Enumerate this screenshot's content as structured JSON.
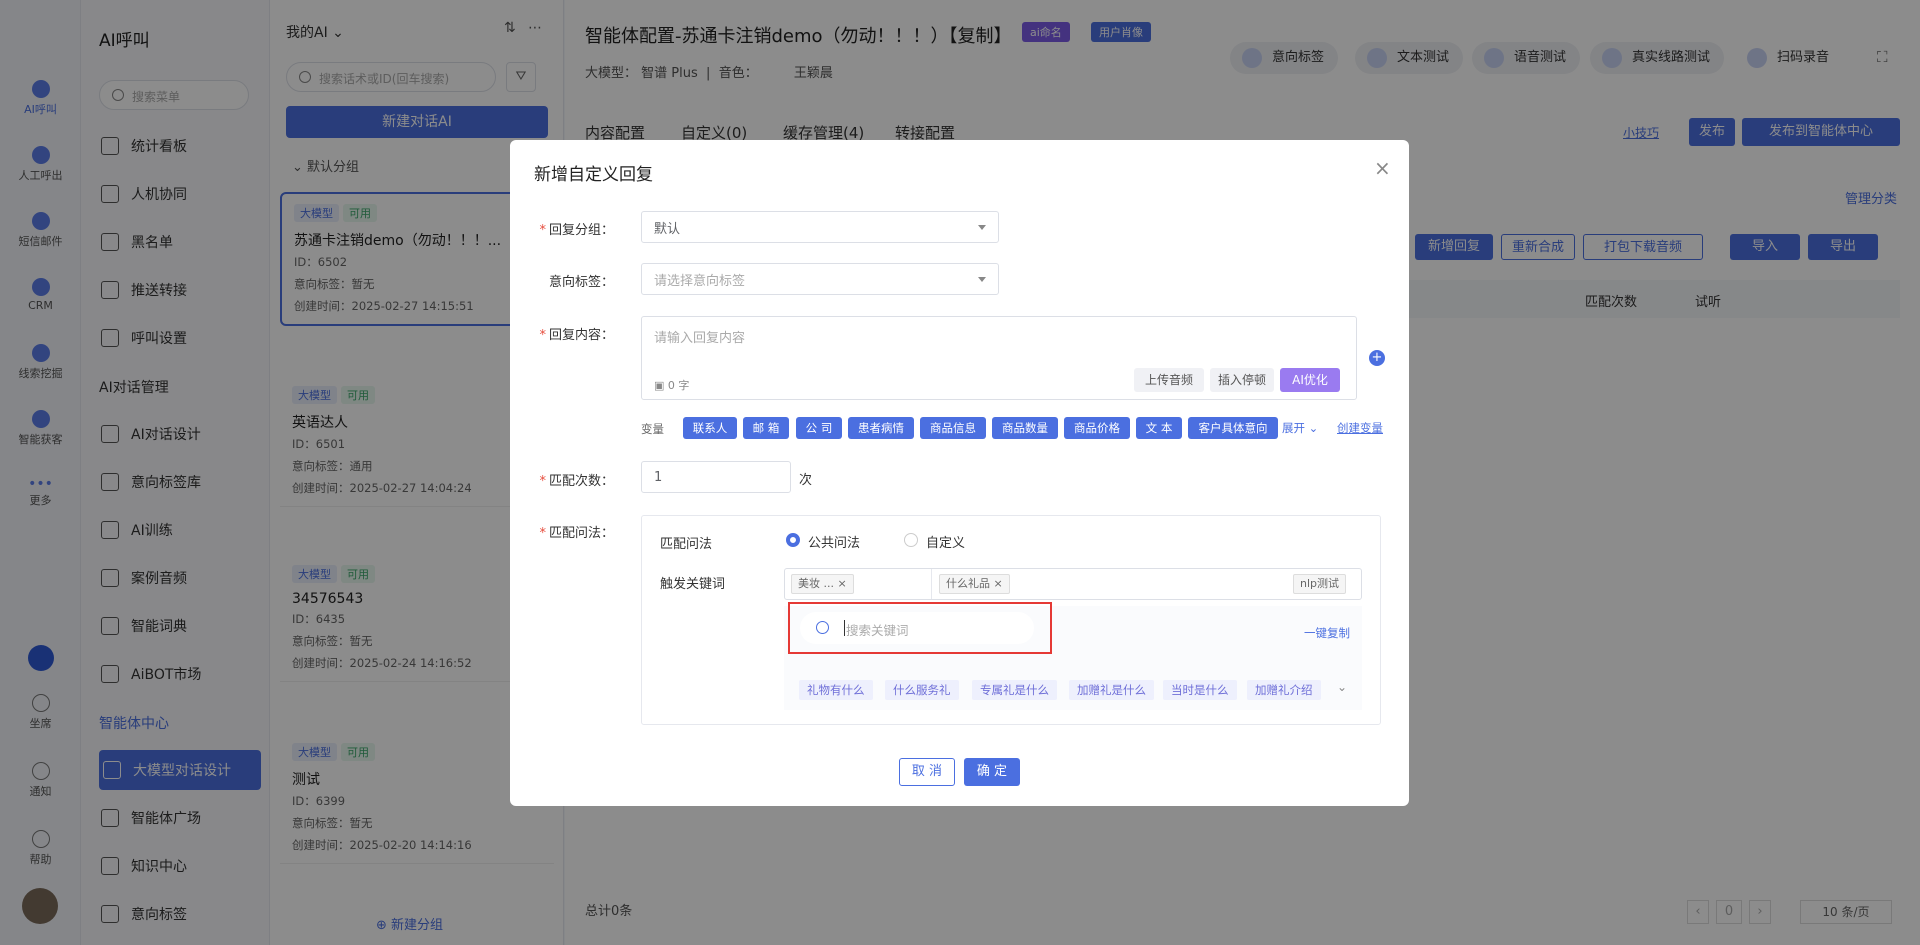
{
  "rail": {
    "items": [
      "AI呼叫",
      "人工呼出",
      "短信邮件",
      "CRM",
      "线索挖掘",
      "智能获客",
      "更多"
    ],
    "bottom": [
      "坐席",
      "通知",
      "帮助"
    ]
  },
  "nav": {
    "title": "AI呼叫",
    "search_placeholder": "搜索菜单",
    "items": [
      "统计看板",
      "人机协同",
      "黑名单",
      "推送转接",
      "呼叫设置"
    ],
    "section2": "AI对话管理",
    "items2": [
      "AI对话设计",
      "意向标签库",
      "AI训练",
      "案例音频",
      "智能词典",
      "AiBOT市场"
    ],
    "section3": "智能体中心",
    "items3": [
      "大模型对话设计",
      "智能体广场",
      "知识中心",
      "意向标签"
    ]
  },
  "list": {
    "filter": "我的AI",
    "search_placeholder": "搜索话术或ID(回车搜索)",
    "new_button": "新建对话AI",
    "group": "默认分组",
    "add_group": "新建分组",
    "cards": [
      {
        "tag": "大模型",
        "status": "可用",
        "title": "苏通卡注销demo（勿动！！！...",
        "id": "ID：6502",
        "intent": "意向标签：暂无",
        "created": "创建时间：2025-02-27 14:15:51"
      },
      {
        "tag": "大模型",
        "status": "可用",
        "title": "英语达人",
        "id": "ID：6501",
        "intent": "意向标签：通用",
        "created": "创建时间：2025-02-27 14:04:24"
      },
      {
        "tag": "大模型",
        "status": "可用",
        "title": "34576543",
        "id": "ID：6435",
        "intent": "意向标签：暂无",
        "created": "创建时间：2025-02-24 14:16:52"
      },
      {
        "tag": "大模型",
        "status": "可用",
        "title": "测试",
        "id": "ID：6399",
        "intent": "意向标签：暂无",
        "created": "创建时间：2025-02-20 14:14:16"
      }
    ]
  },
  "main": {
    "title": "智能体配置-苏通卡注销demo（勿动！！！）【复制】",
    "badge1": "ai命名",
    "badge2": "用户肖像",
    "model_label": "大模型：",
    "model": "智谱 Plus",
    "voice_label": "音色：",
    "voice": "王颖晨",
    "top_buttons": [
      "意向标签",
      "文本测试",
      "语音测试",
      "真实线路测试",
      "扫码录音"
    ],
    "tabs": [
      "内容配置",
      "自定义(0)",
      "缓存管理(4)",
      "转接配置"
    ],
    "tips": "小技巧",
    "publish": "发布",
    "publish_center": "发布到智能体中心",
    "manage": "管理分类",
    "toolbar": [
      "新增回复",
      "重新合成",
      "打包下载音频",
      "导入",
      "导出"
    ],
    "col_match": "匹配次数",
    "col_listen": "试听",
    "total": "总计0条",
    "page": "0",
    "page_size": "10 条/页"
  },
  "modal": {
    "title": "新增自定义回复",
    "group_label": "回复分组：",
    "group_value": "默认",
    "intent_label": "意向标签：",
    "intent_placeholder": "请选择意向标签",
    "content_label": "回复内容：",
    "content_placeholder": "请输入回复内容",
    "char_count": "0 字",
    "upload": "上传音频",
    "pause": "插入停顿",
    "ai_opt": "AI优化",
    "var_label": "变量",
    "vars": [
      "联系人",
      "邮 箱",
      "公 司",
      "患者病情",
      "商品信息",
      "商品数量",
      "商品价格",
      "文 本",
      "客户具体意向"
    ],
    "expand": "展开",
    "create_var": "创建变量",
    "count_label": "匹配次数：",
    "count_value": "1",
    "count_unit": "次",
    "method_label": "匹配问法：",
    "method_inner": "匹配问法",
    "radio_public": "公共问法",
    "radio_custom": "自定义",
    "trigger_label": "触发关键词",
    "chip1": "美妆 ...",
    "chip2": "什么礼品",
    "nlp": "nlp测试",
    "kw_search_placeholder": "搜索关键词",
    "copy_all": "一键复制",
    "keywords": [
      "礼物有什么",
      "什么服务礼",
      "专属礼是什么",
      "加赠礼是什么",
      "当时是什么",
      "加赠礼介绍"
    ],
    "cancel": "取 消",
    "ok": "确 定"
  }
}
